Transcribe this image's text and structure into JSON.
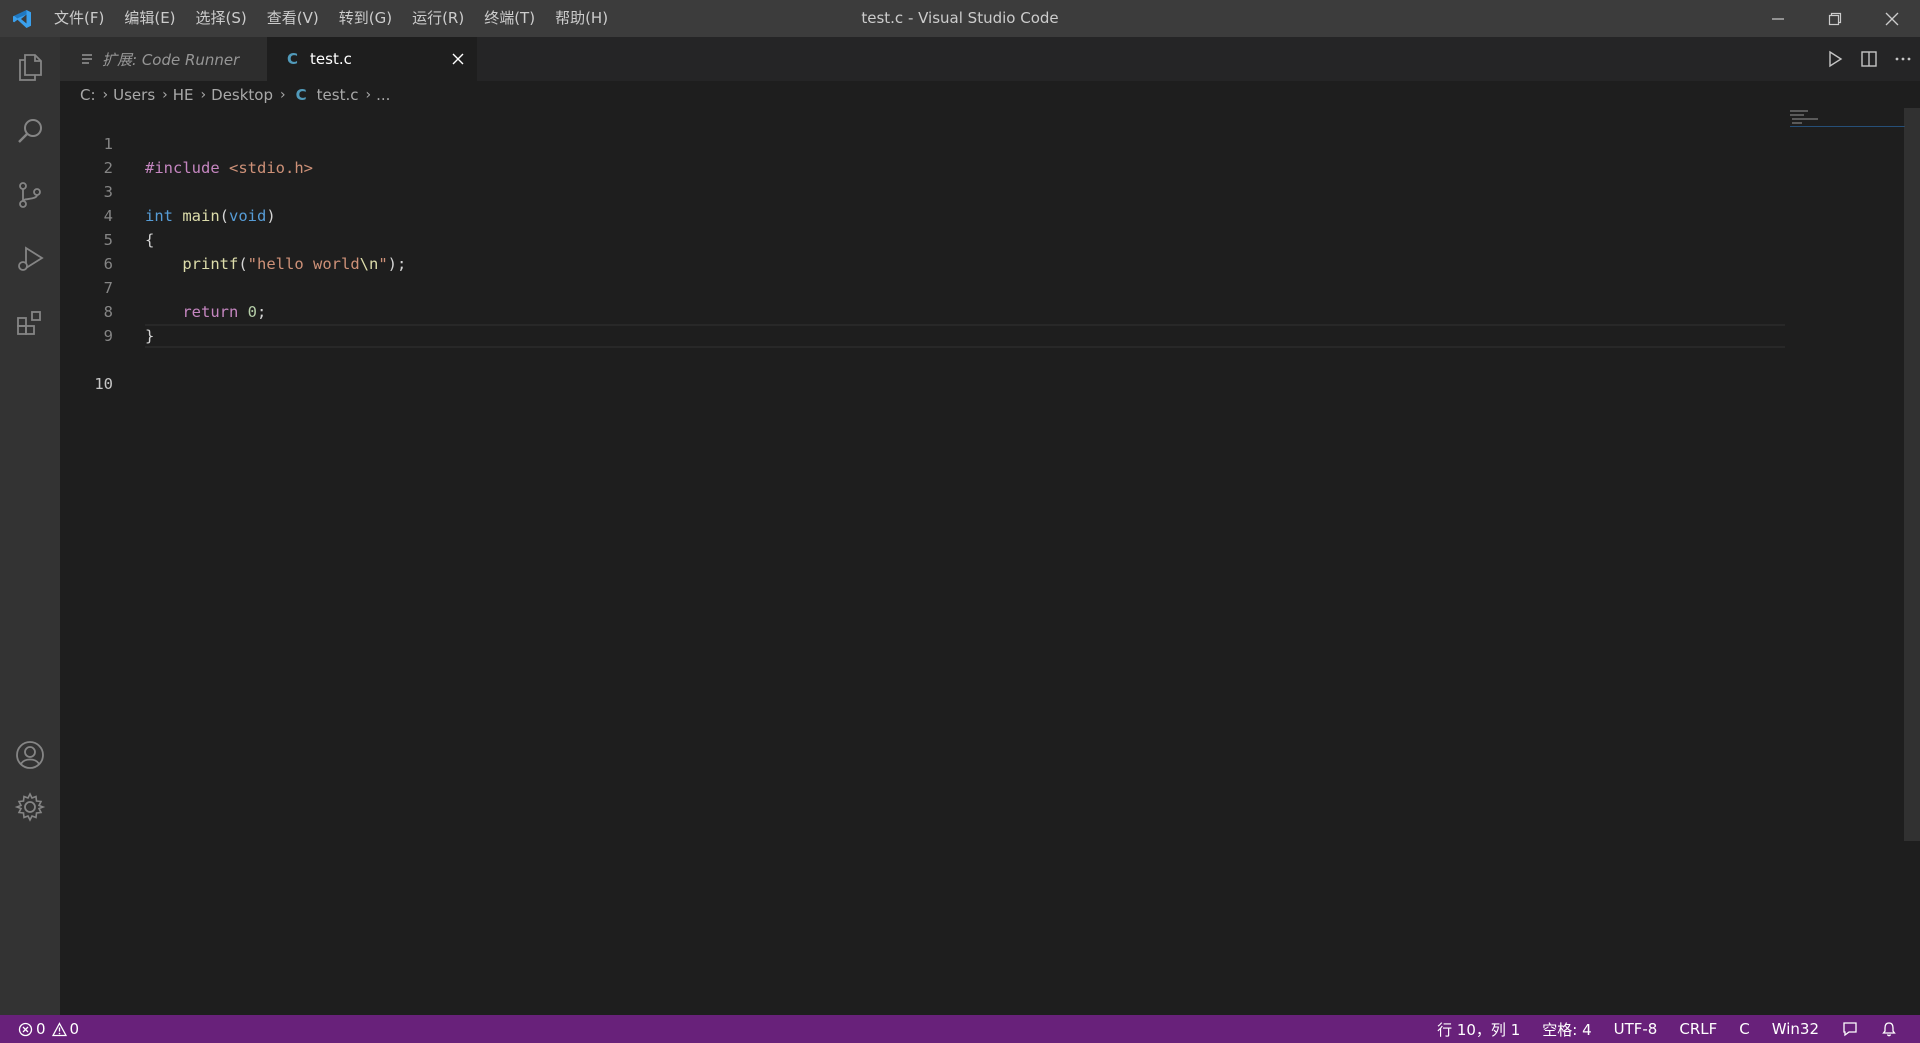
{
  "window": {
    "title": "test.c - Visual Studio Code"
  },
  "menu": [
    "文件(F)",
    "编辑(E)",
    "选择(S)",
    "查看(V)",
    "转到(G)",
    "运行(R)",
    "终端(T)",
    "帮助(H)"
  ],
  "tabs": [
    {
      "label": "扩展: Code Runner",
      "icon": "preview-icon",
      "active": false
    },
    {
      "label": "test.c",
      "icon": "c-file-icon",
      "active": true
    }
  ],
  "tab_file_icon_letter": "C",
  "breadcrumb": {
    "parts": [
      "C:",
      "Users",
      "HE",
      "Desktop"
    ],
    "file_icon_letter": "C",
    "file": "test.c",
    "trail": "..."
  },
  "editor": {
    "lines": [
      {
        "n": "1",
        "text": "#include <stdio.h>"
      },
      {
        "n": "2",
        "text": ""
      },
      {
        "n": "3",
        "text": "int main(void)"
      },
      {
        "n": "4",
        "text": "{"
      },
      {
        "n": "5",
        "text": "    printf(\"hello world\\n\");"
      },
      {
        "n": "6",
        "text": ""
      },
      {
        "n": "7",
        "text": "    return 0;"
      },
      {
        "n": "8",
        "text": "}"
      },
      {
        "n": "9",
        "text": ""
      },
      {
        "n": "10",
        "text": ""
      }
    ],
    "active_line": "10"
  },
  "activity_bar": [
    "explorer-icon",
    "search-icon",
    "source-control-icon",
    "run-debug-icon",
    "extensions-icon",
    "account-icon",
    "settings-gear-icon"
  ],
  "statusbar": {
    "errors": "0",
    "warnings": "0",
    "position": "行 10，列 1",
    "indent": "空格: 4",
    "encoding": "UTF-8",
    "eol": "CRLF",
    "language": "C",
    "platform": "Win32"
  },
  "colors": {
    "statusbar": "#68217a",
    "titlebar": "#3c3c3c",
    "activitybar": "#333333",
    "editor": "#1e1e1e"
  }
}
